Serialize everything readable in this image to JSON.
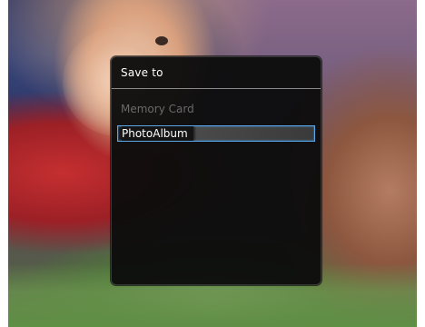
{
  "dialog": {
    "title": "Save to",
    "options": [
      {
        "label": "Memory Card",
        "state": "disabled"
      },
      {
        "label": "PhotoAlbum",
        "state": "selected"
      }
    ]
  },
  "colors": {
    "accent": "#5aa6e6",
    "dialog_bg": "#0c0c0c",
    "disabled_text": "#6a6a6a"
  }
}
